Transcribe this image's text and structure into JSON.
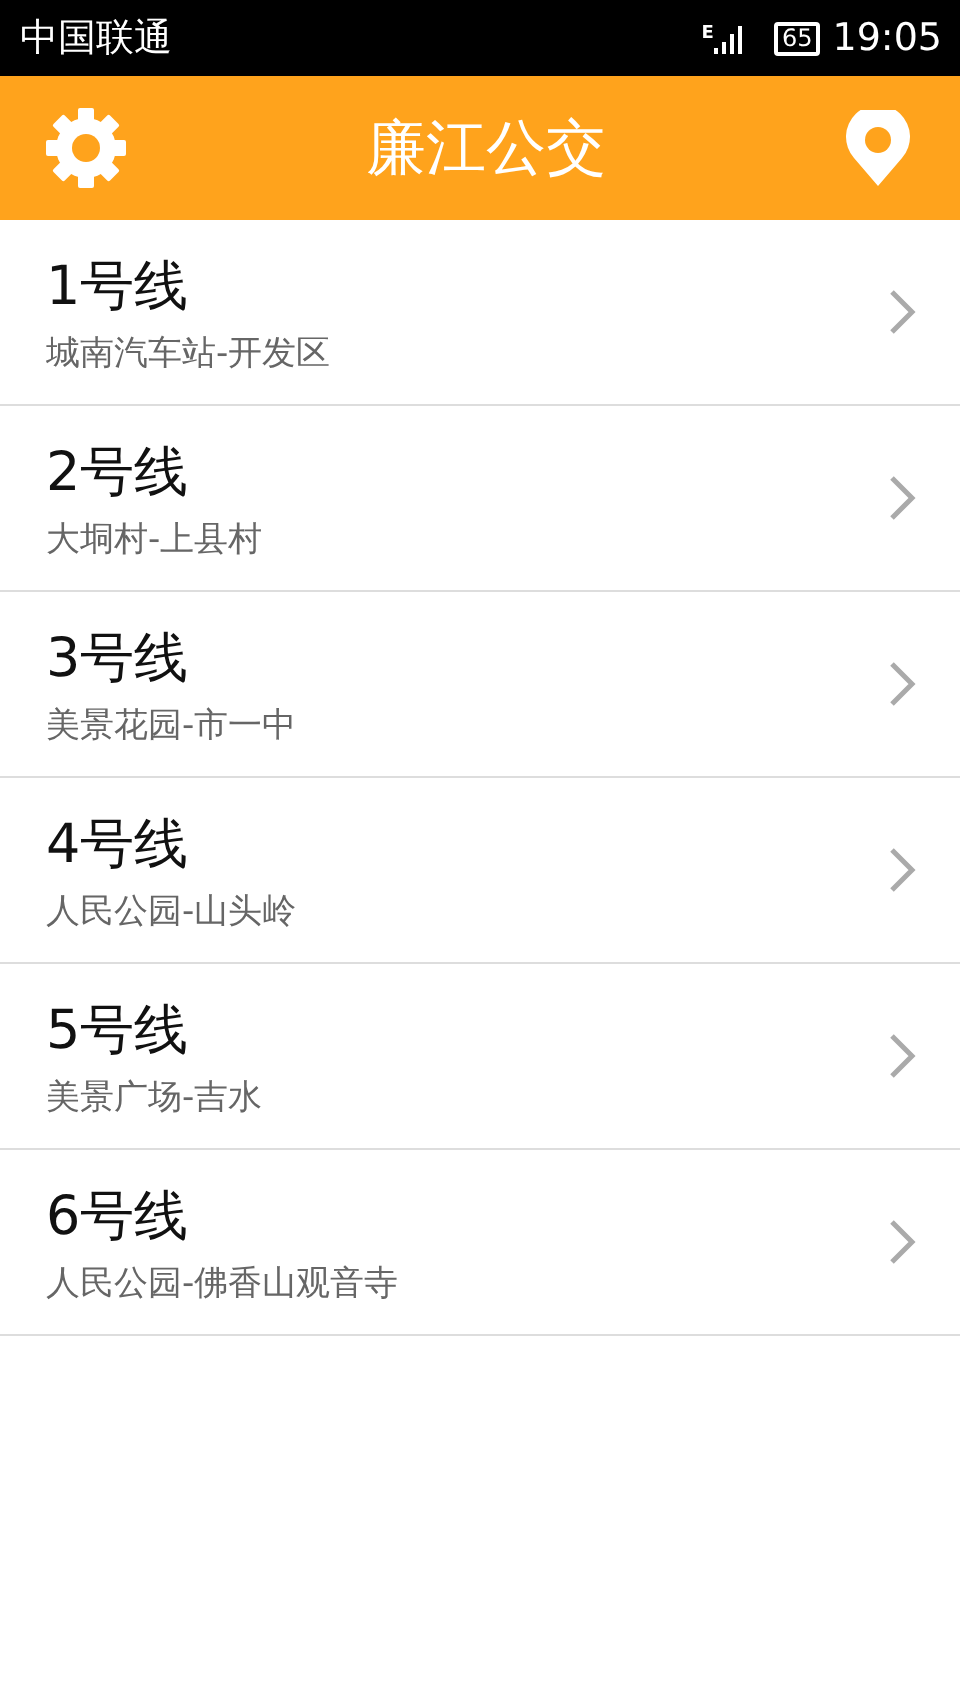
{
  "status_bar": {
    "carrier": "中国联通",
    "network": "E",
    "battery": "65",
    "time": "19:05"
  },
  "header": {
    "title": "廉江公交"
  },
  "routes": [
    {
      "name": "1号线",
      "stops": "城南汽车站-开发区"
    },
    {
      "name": "2号线",
      "stops": "大垌村-上县村"
    },
    {
      "name": "3号线",
      "stops": "美景花园-市一中"
    },
    {
      "name": "4号线",
      "stops": "人民公园-山头岭"
    },
    {
      "name": "5号线",
      "stops": "美景广场-吉水"
    },
    {
      "name": "6号线",
      "stops": "人民公园-佛香山观音寺"
    }
  ]
}
